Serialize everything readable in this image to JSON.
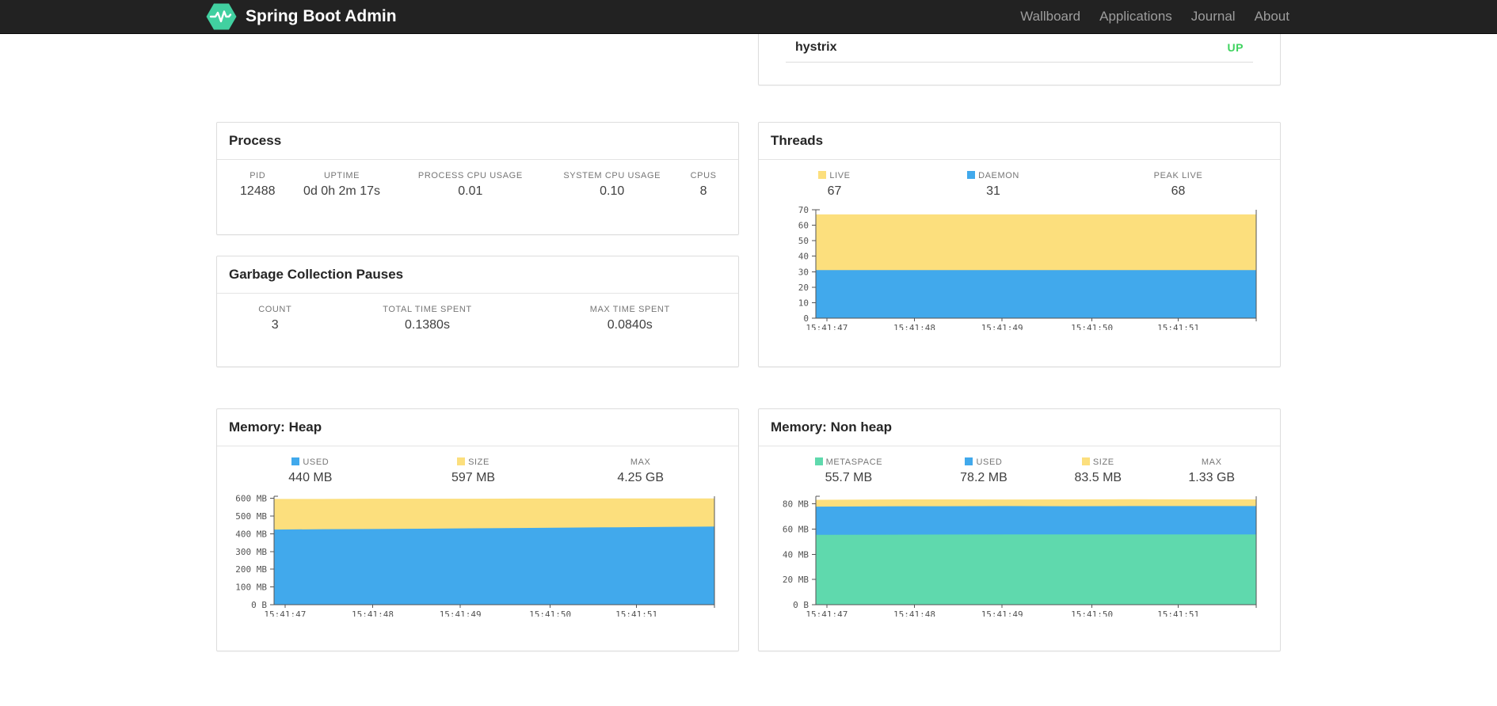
{
  "colors": {
    "navbar_bg": "#222222",
    "brand_green": "#41d0a0",
    "status_up_green": "#3fd35f",
    "chart_yellow": "#fcdf7d",
    "chart_blue": "#41a9ec",
    "chart_green": "#5fd9ad"
  },
  "navbar": {
    "brand": "Spring Boot Admin",
    "items": [
      {
        "label": "Wallboard"
      },
      {
        "label": "Applications"
      },
      {
        "label": "Journal"
      },
      {
        "label": "About"
      }
    ]
  },
  "application_list": {
    "name": "hystrix",
    "status": "UP",
    "status_color": "#3fd35f"
  },
  "panels": {
    "process": {
      "title": "Process",
      "metrics": [
        {
          "label": "PID",
          "value": "12488"
        },
        {
          "label": "UPTIME",
          "value": "0d 0h 2m 17s"
        },
        {
          "label": "PROCESS CPU USAGE",
          "value": "0.01"
        },
        {
          "label": "SYSTEM CPU USAGE",
          "value": "0.10"
        },
        {
          "label": "CPUS",
          "value": "8"
        }
      ]
    },
    "gc": {
      "title": "Garbage Collection Pauses",
      "metrics": [
        {
          "label": "COUNT",
          "value": "3"
        },
        {
          "label": "TOTAL TIME SPENT",
          "value": "0.1380s"
        },
        {
          "label": "MAX TIME SPENT",
          "value": "0.0840s"
        }
      ]
    },
    "threads": {
      "title": "Threads",
      "metrics": [
        {
          "label": "LIVE",
          "value": "67",
          "swatch": "#fcdf7d"
        },
        {
          "label": "DAEMON",
          "value": "31",
          "swatch": "#41a9ec"
        },
        {
          "label": "PEAK LIVE",
          "value": "68"
        }
      ]
    },
    "heap": {
      "title": "Memory: Heap",
      "metrics": [
        {
          "label": "USED",
          "value": "440 MB",
          "swatch": "#41a9ec"
        },
        {
          "label": "SIZE",
          "value": "597 MB",
          "swatch": "#fcdf7d"
        },
        {
          "label": "MAX",
          "value": "4.25 GB"
        }
      ]
    },
    "nonheap": {
      "title": "Memory: Non heap",
      "metrics": [
        {
          "label": "METASPACE",
          "value": "55.7 MB",
          "swatch": "#5fd9ad"
        },
        {
          "label": "USED",
          "value": "78.2 MB",
          "swatch": "#41a9ec"
        },
        {
          "label": "SIZE",
          "value": "83.5 MB",
          "swatch": "#fcdf7d"
        },
        {
          "label": "MAX",
          "value": "1.33 GB"
        }
      ]
    }
  },
  "chart_data": [
    {
      "type": "area",
      "title": "Threads",
      "xlabel": "",
      "ylabel": "",
      "grid": false,
      "legend_position": "top",
      "x_labels": [
        "15:41:47",
        "15:41:48",
        "15:41:49",
        "15:41:50",
        "15:41:51"
      ],
      "x_tick_fracs": [
        0.025,
        0.224,
        0.423,
        0.627,
        0.823
      ],
      "ylim": [
        0,
        70
      ],
      "yticks": [
        {
          "v": 0,
          "label": "0"
        },
        {
          "v": 10,
          "label": "10"
        },
        {
          "v": 20,
          "label": "20"
        },
        {
          "v": 30,
          "label": "30"
        },
        {
          "v": 40,
          "label": "40"
        },
        {
          "v": 50,
          "label": "50"
        },
        {
          "v": 60,
          "label": "60"
        },
        {
          "v": 70,
          "label": "70"
        }
      ],
      "series": [
        {
          "name": "LIVE",
          "color": "#fcdf7d",
          "values": [
            67,
            67,
            67,
            67,
            67,
            67
          ]
        },
        {
          "name": "DAEMON",
          "color": "#41a9ec",
          "values": [
            31,
            31,
            31,
            31,
            31,
            31
          ]
        }
      ]
    },
    {
      "type": "area",
      "title": "Memory: Heap",
      "xlabel": "",
      "ylabel": "",
      "grid": false,
      "legend_position": "top",
      "unit": "MB",
      "x_labels": [
        "15:41:47",
        "15:41:48",
        "15:41:49",
        "15:41:50",
        "15:41:51"
      ],
      "x_tick_fracs": [
        0.025,
        0.224,
        0.423,
        0.627,
        0.823
      ],
      "ylim": [
        0,
        612
      ],
      "yticks": [
        {
          "v": 0,
          "label": "0 B"
        },
        {
          "v": 100,
          "label": "100 MB"
        },
        {
          "v": 200,
          "label": "200 MB"
        },
        {
          "v": 300,
          "label": "300 MB"
        },
        {
          "v": 400,
          "label": "400 MB"
        },
        {
          "v": 500,
          "label": "500 MB"
        },
        {
          "v": 600,
          "label": "600 MB"
        }
      ],
      "series": [
        {
          "name": "SIZE",
          "color": "#fcdf7d",
          "values": [
            597,
            597,
            598,
            598,
            598,
            599,
            599,
            600,
            600,
            600
          ]
        },
        {
          "name": "USED",
          "color": "#41a9ec",
          "values": [
            424,
            426,
            427,
            429,
            431,
            433,
            435,
            437,
            439,
            441
          ]
        }
      ]
    },
    {
      "type": "area",
      "title": "Memory: Non heap",
      "xlabel": "",
      "ylabel": "",
      "grid": false,
      "legend_position": "top",
      "unit": "MB",
      "x_labels": [
        "15:41:47",
        "15:41:48",
        "15:41:49",
        "15:41:50",
        "15:41:51"
      ],
      "x_tick_fracs": [
        0.025,
        0.224,
        0.423,
        0.627,
        0.823
      ],
      "ylim": [
        0,
        86
      ],
      "yticks": [
        {
          "v": 0,
          "label": "0 B"
        },
        {
          "v": 20,
          "label": "20 MB"
        },
        {
          "v": 40,
          "label": "40 MB"
        },
        {
          "v": 60,
          "label": "60 MB"
        },
        {
          "v": 80,
          "label": "80 MB"
        }
      ],
      "series": [
        {
          "name": "SIZE",
          "color": "#fcdf7d",
          "values": [
            83.2,
            83.4,
            83.5,
            83.4,
            83.5,
            83.6,
            83.5,
            83.5
          ]
        },
        {
          "name": "USED",
          "color": "#41a9ec",
          "values": [
            77.8,
            78.0,
            78.1,
            78.2,
            78.1,
            78.2,
            78.2,
            78.2
          ]
        },
        {
          "name": "METASPACE",
          "color": "#5fd9ad",
          "values": [
            55.4,
            55.5,
            55.6,
            55.7,
            55.7,
            55.7,
            55.7,
            55.7
          ]
        }
      ]
    }
  ]
}
